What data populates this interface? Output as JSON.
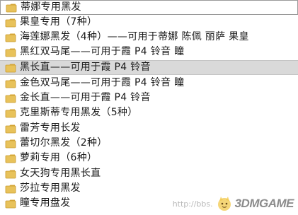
{
  "folders": [
    {
      "label": "蒂娜专用黑发"
    },
    {
      "label": "果皇专用（7种）"
    },
    {
      "label": "海莲娜黑发（4种）——可用于蒂娜 陈佩 丽萨 果皇"
    },
    {
      "label": "黑红双马尾——可用于霞 P4 铃音 瞳"
    },
    {
      "label": "黑长直——可用于霞 P4 铃音"
    },
    {
      "label": "金色双马尾——可用于霞 P4 铃音 瞳"
    },
    {
      "label": "金长直——可用于霞 P4 铃音"
    },
    {
      "label": "克里斯蒂专用黑发（5种）"
    },
    {
      "label": "雷芳专用长发"
    },
    {
      "label": "蕾切尔黑发（2种）"
    },
    {
      "label": "萝莉专用（6种）"
    },
    {
      "label": "女天狗专用黑长直"
    },
    {
      "label": "莎拉专用黑发"
    },
    {
      "label": "瞳专用盘发"
    }
  ],
  "selected_index": 4,
  "watermark": {
    "url_text": "http://bbs.",
    "logo_text": "3DMGAME"
  },
  "colors": {
    "folder_body": "#e8c25a",
    "folder_tab": "#d9a93a",
    "selection_bg": "#d9d9d9"
  }
}
